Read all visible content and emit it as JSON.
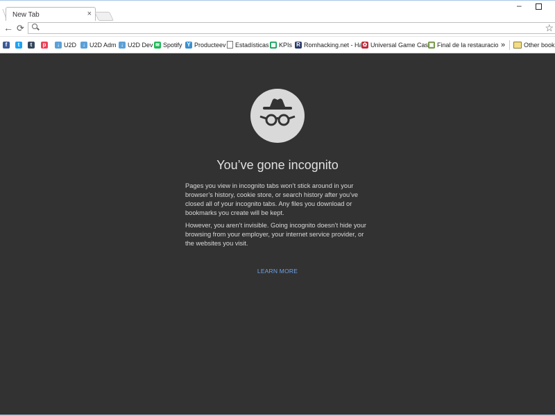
{
  "tab": {
    "title": "New Tab",
    "close_glyph": "×"
  },
  "window_controls": {
    "minimize": "–"
  },
  "toolbar": {
    "back_glyph": "←",
    "reload_glyph": "⟳",
    "star_glyph": "☆"
  },
  "omnibox": {
    "value": "",
    "placeholder": ""
  },
  "bookmarks": [
    {
      "label": "",
      "icon": "facebook-icon",
      "color": "#3b5998",
      "glyph": "f"
    },
    {
      "label": "",
      "icon": "twitter-icon",
      "color": "#1da1f2",
      "glyph": "t"
    },
    {
      "label": "",
      "icon": "tumblr-icon",
      "color": "#35465c",
      "glyph": "t"
    },
    {
      "label": "",
      "icon": "pocket-icon",
      "color": "#ef4056",
      "glyph": "p"
    },
    {
      "label": "U2D",
      "icon": "u2d-icon",
      "color": "#5aa0d8",
      "glyph": "↓"
    },
    {
      "label": "U2D Adm",
      "icon": "u2d-icon",
      "color": "#5aa0d8",
      "glyph": "↓"
    },
    {
      "label": "U2D Dev",
      "icon": "u2d-icon",
      "color": "#5aa0d8",
      "glyph": "↓"
    },
    {
      "label": "Spotify",
      "icon": "spotify-icon",
      "color": "#1db954",
      "glyph": "≋"
    },
    {
      "label": "Producteev",
      "icon": "producteev-icon",
      "color": "#3a8fd0",
      "glyph": "Y"
    },
    {
      "label": "Estadísticas",
      "icon": "page-icon",
      "color": "#ffffff",
      "glyph": ""
    },
    {
      "label": "KPIs",
      "icon": "sheets-icon",
      "color": "#0f9d58",
      "glyph": "▦"
    },
    {
      "label": "Romhacking.net - Ha",
      "icon": "romhacking-icon",
      "color": "#2a3b6a",
      "glyph": "R"
    },
    {
      "label": "Universal Game Case",
      "icon": "game-case-icon",
      "color": "#c0283a",
      "glyph": "✿"
    },
    {
      "label": "Final de la restauracio",
      "icon": "restoration-icon",
      "color": "#6a8f3a",
      "glyph": "▣"
    }
  ],
  "bookmarks_overflow": "»",
  "other_bookmarks": "Other bookm",
  "incognito": {
    "headline": "You’ve gone incognito",
    "para1": "Pages you view in incognito tabs won’t stick around in your browser’s history, cookie store, or search history after you’ve closed all of your incognito tabs. Any files you download or bookmarks you create will be kept.",
    "para2": "However, you aren’t invisible. Going incognito doesn’t hide your browsing from your employer, your internet service provider, or the websites you visit.",
    "learn_more": "LEARN MORE"
  },
  "colors": {
    "page_bg": "#323232",
    "link": "#6fa3e9",
    "circle": "#d9d9d9"
  }
}
